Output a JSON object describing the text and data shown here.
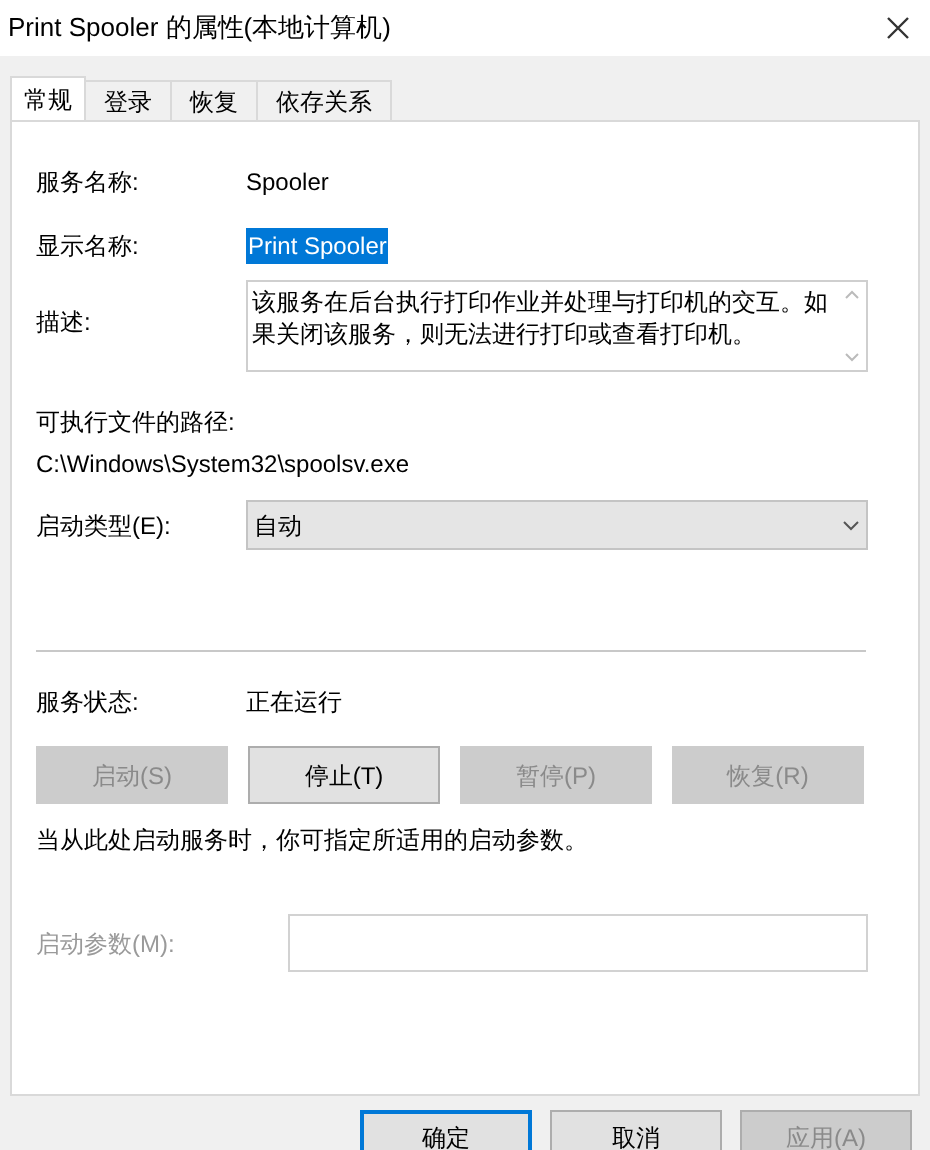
{
  "window": {
    "title": "Print Spooler 的属性(本地计算机)"
  },
  "tabs": [
    {
      "label": "常规",
      "selected": true
    },
    {
      "label": "登录",
      "selected": false
    },
    {
      "label": "恢复",
      "selected": false
    },
    {
      "label": "依存关系",
      "selected": false
    }
  ],
  "service_name": {
    "label": "服务名称:",
    "value": "Spooler"
  },
  "display_name": {
    "label": "显示名称:",
    "value": "Print Spooler",
    "selected": true
  },
  "description": {
    "label": "描述:",
    "value": "该服务在后台执行打印作业并处理与打印机的交互。如果关闭该服务，则无法进行打印或查看打印机。"
  },
  "executable_path": {
    "label": "可执行文件的路径:",
    "value": "C:\\Windows\\System32\\spoolsv.exe"
  },
  "startup_type": {
    "label": "启动类型(E):",
    "value": "自动"
  },
  "service_status": {
    "label": "服务状态:",
    "value": "正在运行"
  },
  "control_buttons": [
    {
      "label": "启动(S)",
      "disabled": true
    },
    {
      "label": "停止(T)",
      "disabled": false
    },
    {
      "label": "暂停(P)",
      "disabled": true
    },
    {
      "label": "恢复(R)",
      "disabled": true
    }
  ],
  "hint": "当从此处启动服务时，你可指定所适用的启动参数。",
  "start_parameters": {
    "label": "启动参数(M):",
    "disabled": true
  },
  "dialog_buttons": [
    {
      "label": "确定",
      "default": true,
      "disabled": false
    },
    {
      "label": "取消",
      "default": false,
      "disabled": false
    },
    {
      "label": "应用(A)",
      "default": false,
      "disabled": true
    }
  ]
}
